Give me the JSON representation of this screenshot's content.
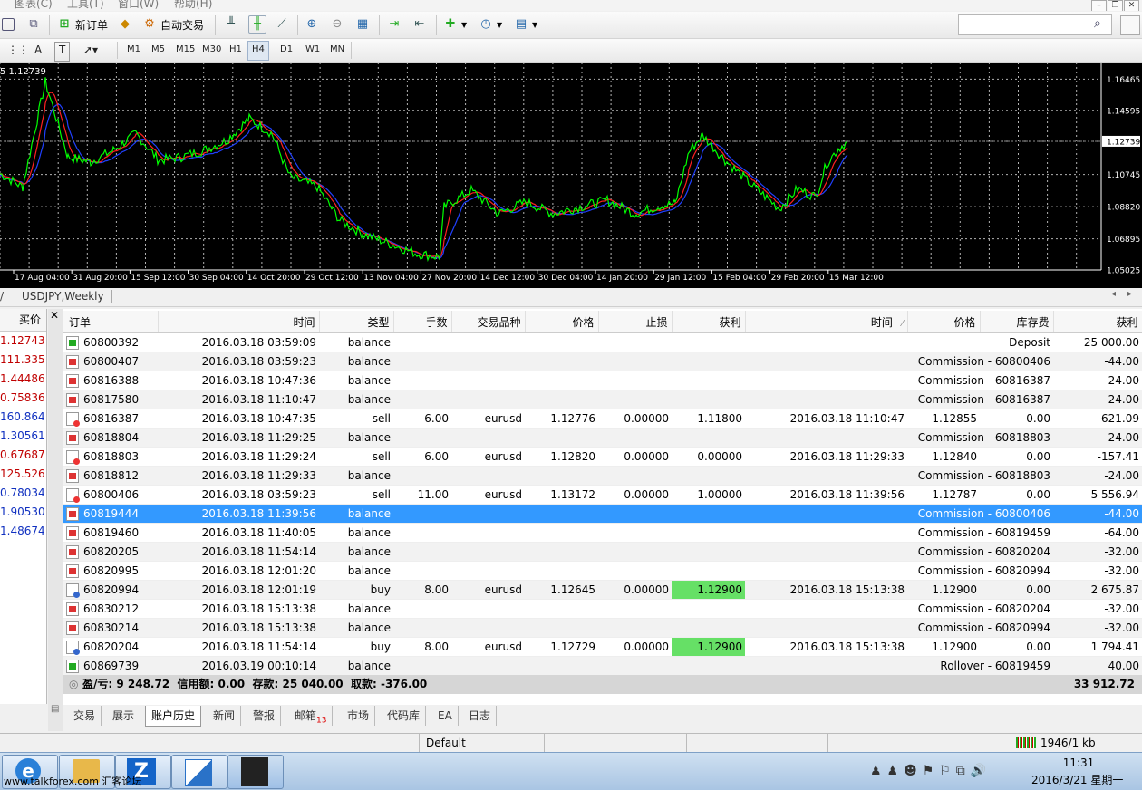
{
  "menu": [
    "图表(C)",
    "工具(T)",
    "窗口(W)",
    "帮助(H)"
  ],
  "toolbar": {
    "new_order": "新订单",
    "auto_trading": "自动交易"
  },
  "timeframes": [
    "M1",
    "M5",
    "M15",
    "M30",
    "H1",
    "H4",
    "D1",
    "W1",
    "MN"
  ],
  "active_timeframe": "H4",
  "chart": {
    "corner_label": "5 1.12739",
    "current_price": "1.12739",
    "price_ticks": [
      "1.16465",
      "1.14595",
      "1.12739",
      "1.10745",
      "1.08820",
      "1.06895",
      "1.05025"
    ],
    "time_ticks": [
      "17 Aug 04:00",
      "31 Aug 20:00",
      "15 Sep 12:00",
      "30 Sep 04:00",
      "14 Oct 20:00",
      "29 Oct 12:00",
      "13 Nov 04:00",
      "27 Nov 20:00",
      "14 Dec 12:00",
      "30 Dec 04:00",
      "14 Jan 20:00",
      "29 Jan 12:00",
      "15 Feb 04:00",
      "29 Feb 20:00",
      "15 Mar 12:00"
    ],
    "tab": "USDJPY,Weekly",
    "colors": {
      "price": "#00ff00",
      "ma_fast": "#ff2020",
      "ma_slow": "#2040ff",
      "grid": "#ffffff"
    }
  },
  "market_watch": {
    "header": "买价",
    "rows": [
      {
        "v": "1.12743",
        "c": "#c00000"
      },
      {
        "v": "111.335",
        "c": "#c00000"
      },
      {
        "v": "1.44486",
        "c": "#c00000"
      },
      {
        "v": "0.75836",
        "c": "#c00000"
      },
      {
        "v": "160.864",
        "c": "#1030c0"
      },
      {
        "v": "1.30561",
        "c": "#1030c0"
      },
      {
        "v": "0.67687",
        "c": "#c00000"
      },
      {
        "v": "125.526",
        "c": "#c00000"
      },
      {
        "v": "0.78034",
        "c": "#1030c0"
      },
      {
        "v": "1.90530",
        "c": "#1030c0"
      },
      {
        "v": "1.48674",
        "c": "#1030c0"
      }
    ]
  },
  "history": {
    "columns": [
      "订单",
      "时间",
      "类型",
      "手数",
      "交易品种",
      "价格",
      "止损",
      "获利",
      "时间",
      "价格",
      "库存费",
      "获利"
    ],
    "rows": [
      {
        "order": "60800392",
        "time": "2016.03.18 03:59:09",
        "type": "balance",
        "comment": "Deposit",
        "profit": "25 000.00",
        "icon": "up"
      },
      {
        "order": "60800407",
        "time": "2016.03.18 03:59:23",
        "type": "balance",
        "comment": "Commission - 60800406",
        "profit": "-44.00",
        "icon": "bal"
      },
      {
        "order": "60816388",
        "time": "2016.03.18 10:47:36",
        "type": "balance",
        "comment": "Commission - 60816387",
        "profit": "-24.00",
        "icon": "bal"
      },
      {
        "order": "60817580",
        "time": "2016.03.18 11:10:47",
        "type": "balance",
        "comment": "Commission - 60816387",
        "profit": "-24.00",
        "icon": "bal"
      },
      {
        "order": "60816387",
        "time": "2016.03.18 10:47:35",
        "type": "sell",
        "lots": "6.00",
        "symbol": "eurusd",
        "price": "1.12776",
        "sl": "0.00000",
        "tp": "1.11800",
        "ctime": "2016.03.18 11:10:47",
        "cprice": "1.12855",
        "swap": "0.00",
        "profit": "-621.09",
        "icon": "sell"
      },
      {
        "order": "60818804",
        "time": "2016.03.18 11:29:25",
        "type": "balance",
        "comment": "Commission - 60818803",
        "profit": "-24.00",
        "icon": "bal"
      },
      {
        "order": "60818803",
        "time": "2016.03.18 11:29:24",
        "type": "sell",
        "lots": "6.00",
        "symbol": "eurusd",
        "price": "1.12820",
        "sl": "0.00000",
        "tp": "0.00000",
        "ctime": "2016.03.18 11:29:33",
        "cprice": "1.12840",
        "swap": "0.00",
        "profit": "-157.41",
        "icon": "sell"
      },
      {
        "order": "60818812",
        "time": "2016.03.18 11:29:33",
        "type": "balance",
        "comment": "Commission - 60818803",
        "profit": "-24.00",
        "icon": "bal"
      },
      {
        "order": "60800406",
        "time": "2016.03.18 03:59:23",
        "type": "sell",
        "lots": "11.00",
        "symbol": "eurusd",
        "price": "1.13172",
        "sl": "0.00000",
        "tp": "1.00000",
        "ctime": "2016.03.18 11:39:56",
        "cprice": "1.12787",
        "swap": "0.00",
        "profit": "5 556.94",
        "icon": "sell"
      },
      {
        "order": "60819444",
        "time": "2016.03.18 11:39:56",
        "type": "balance",
        "comment": "Commission - 60800406",
        "profit": "-44.00",
        "icon": "bal",
        "selected": true
      },
      {
        "order": "60819460",
        "time": "2016.03.18 11:40:05",
        "type": "balance",
        "comment": "Commission - 60819459",
        "profit": "-64.00",
        "icon": "bal"
      },
      {
        "order": "60820205",
        "time": "2016.03.18 11:54:14",
        "type": "balance",
        "comment": "Commission - 60820204",
        "profit": "-32.00",
        "icon": "bal"
      },
      {
        "order": "60820995",
        "time": "2016.03.18 12:01:20",
        "type": "balance",
        "comment": "Commission - 60820994",
        "profit": "-32.00",
        "icon": "bal"
      },
      {
        "order": "60820994",
        "time": "2016.03.18 12:01:19",
        "type": "buy",
        "lots": "8.00",
        "symbol": "eurusd",
        "price": "1.12645",
        "sl": "0.00000",
        "tp": "1.12900",
        "tp_hit": true,
        "ctime": "2016.03.18 15:13:38",
        "cprice": "1.12900",
        "swap": "0.00",
        "profit": "2 675.87",
        "icon": "buy"
      },
      {
        "order": "60830212",
        "time": "2016.03.18 15:13:38",
        "type": "balance",
        "comment": "Commission - 60820204",
        "profit": "-32.00",
        "icon": "bal"
      },
      {
        "order": "60830214",
        "time": "2016.03.18 15:13:38",
        "type": "balance",
        "comment": "Commission - 60820994",
        "profit": "-32.00",
        "icon": "bal"
      },
      {
        "order": "60820204",
        "time": "2016.03.18 11:54:14",
        "type": "buy",
        "lots": "8.00",
        "symbol": "eurusd",
        "price": "1.12729",
        "sl": "0.00000",
        "tp": "1.12900",
        "tp_hit": true,
        "ctime": "2016.03.18 15:13:38",
        "cprice": "1.12900",
        "swap": "0.00",
        "profit": "1 794.41",
        "icon": "buy"
      },
      {
        "order": "60869739",
        "time": "2016.03.19 00:10:14",
        "type": "balance",
        "comment": "Rollover - 60819459",
        "profit": "40.00",
        "icon": "up"
      }
    ],
    "summary_left": "盈/亏: 9 248.72  信用额: 0.00  存款: 25 040.00  取款: -376.00",
    "summary_right": "33 912.72"
  },
  "bottom_tabs": [
    "交易",
    "展示",
    "账户历史",
    "新闻",
    "警报",
    "邮箱",
    "市场",
    "代码库",
    "EA",
    "日志"
  ],
  "mail_count": "13",
  "active_bottom_tab": "账户历史",
  "status": {
    "profile": "Default",
    "traffic": "1946/1 kb"
  },
  "taskbar": {
    "watermark": "www.talkforex.com 汇客论坛",
    "time": "11:31",
    "date": "2016/3/21 星期一"
  }
}
